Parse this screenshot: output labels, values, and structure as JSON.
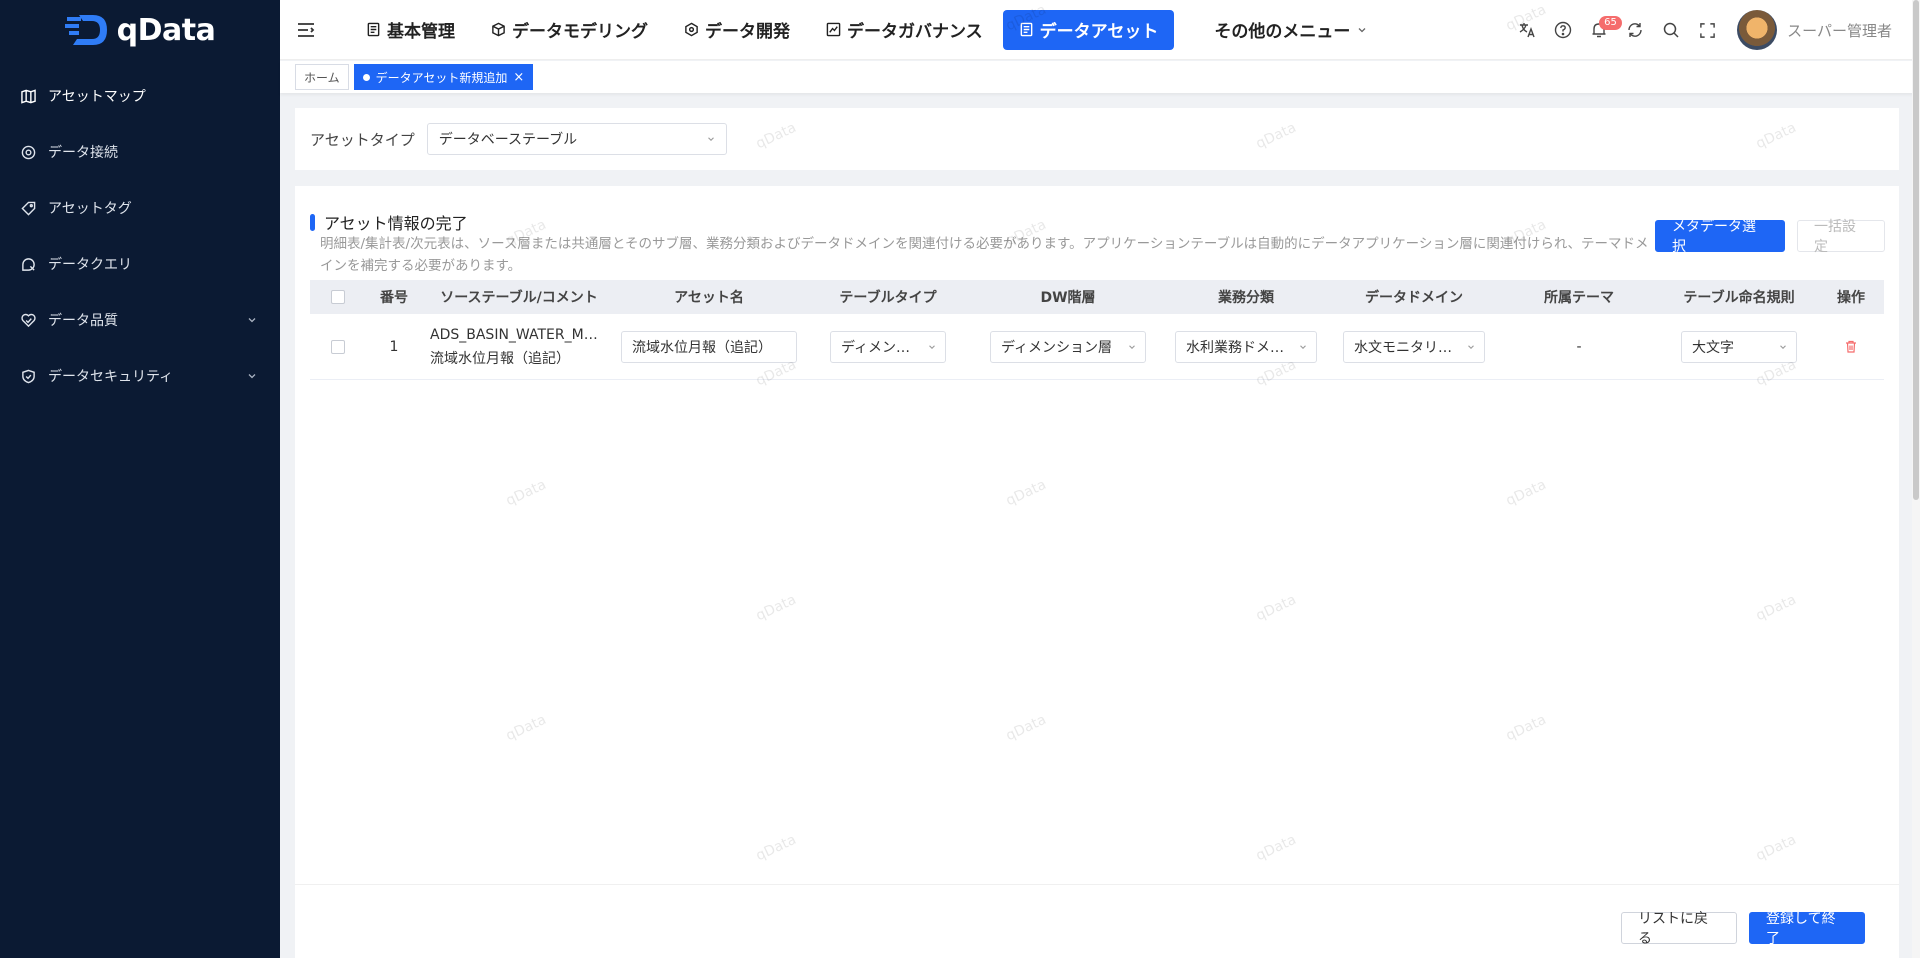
{
  "app": {
    "logo_text": "qData"
  },
  "sidebar": {
    "items": [
      {
        "label": "アセットマップ",
        "icon": "map-icon"
      },
      {
        "label": "データ接続",
        "icon": "target-icon"
      },
      {
        "label": "アセットタグ",
        "icon": "tag-icon"
      },
      {
        "label": "データクエリ",
        "icon": "search-doc-icon"
      },
      {
        "label": "データ品質",
        "icon": "quality-icon"
      },
      {
        "label": "データセキュリティ",
        "icon": "shield-icon"
      }
    ]
  },
  "header": {
    "nav": [
      {
        "label": "基本管理"
      },
      {
        "label": "データモデリング"
      },
      {
        "label": "データ開発"
      },
      {
        "label": "データガバナンス"
      },
      {
        "label": "データアセット"
      },
      {
        "label": "その他のメニュー"
      }
    ],
    "notification_count": "65",
    "user_name": "スーパー管理者"
  },
  "tabs": {
    "home": "ホーム",
    "current": "データアセット新規追加",
    "close": "×"
  },
  "filter": {
    "label": "アセットタイプ",
    "value": "データベーステーブル"
  },
  "section": {
    "title": "アセット情報の完了",
    "description": "明細表/集計表/次元表は、ソース層または共通層とそのサブ層、業務分類およびデータドメインを関連付ける必要があります。アプリケーションテーブルは自動的にデータアプリケーション層に関連付けられ、テーマドメインを補完する必要があります。",
    "select_metadata_button": "メタデータ選択",
    "bulk_setting_button": "一括設定"
  },
  "table": {
    "headers": [
      "番号",
      "ソーステーブル/コメント",
      "アセット名",
      "テーブルタイプ",
      "DW階層",
      "業務分類",
      "データドメイン",
      "所属テーマ",
      "テーブル命名規則",
      "操作"
    ],
    "rows": [
      {
        "index": "1",
        "source_table": "ADS_BASIN_WATER_MONTHLY",
        "source_comment": "流域水位月報（追記）",
        "asset_name": "流域水位月報（追記）",
        "table_type": "ディメンション表",
        "dw_layer": "ディメンション層",
        "business_category": "水利業務ドメイン",
        "data_domain": "水文モニタリング",
        "theme": "-",
        "naming_rule": "大文字"
      }
    ]
  },
  "footer": {
    "back_button": "リストに戻る",
    "submit_button": "登録して終了"
  },
  "watermark": "qData",
  "colors": {
    "sidebar_bg": "#0b1a33",
    "primary": "#1e66f5",
    "danger": "#f56c6c"
  }
}
